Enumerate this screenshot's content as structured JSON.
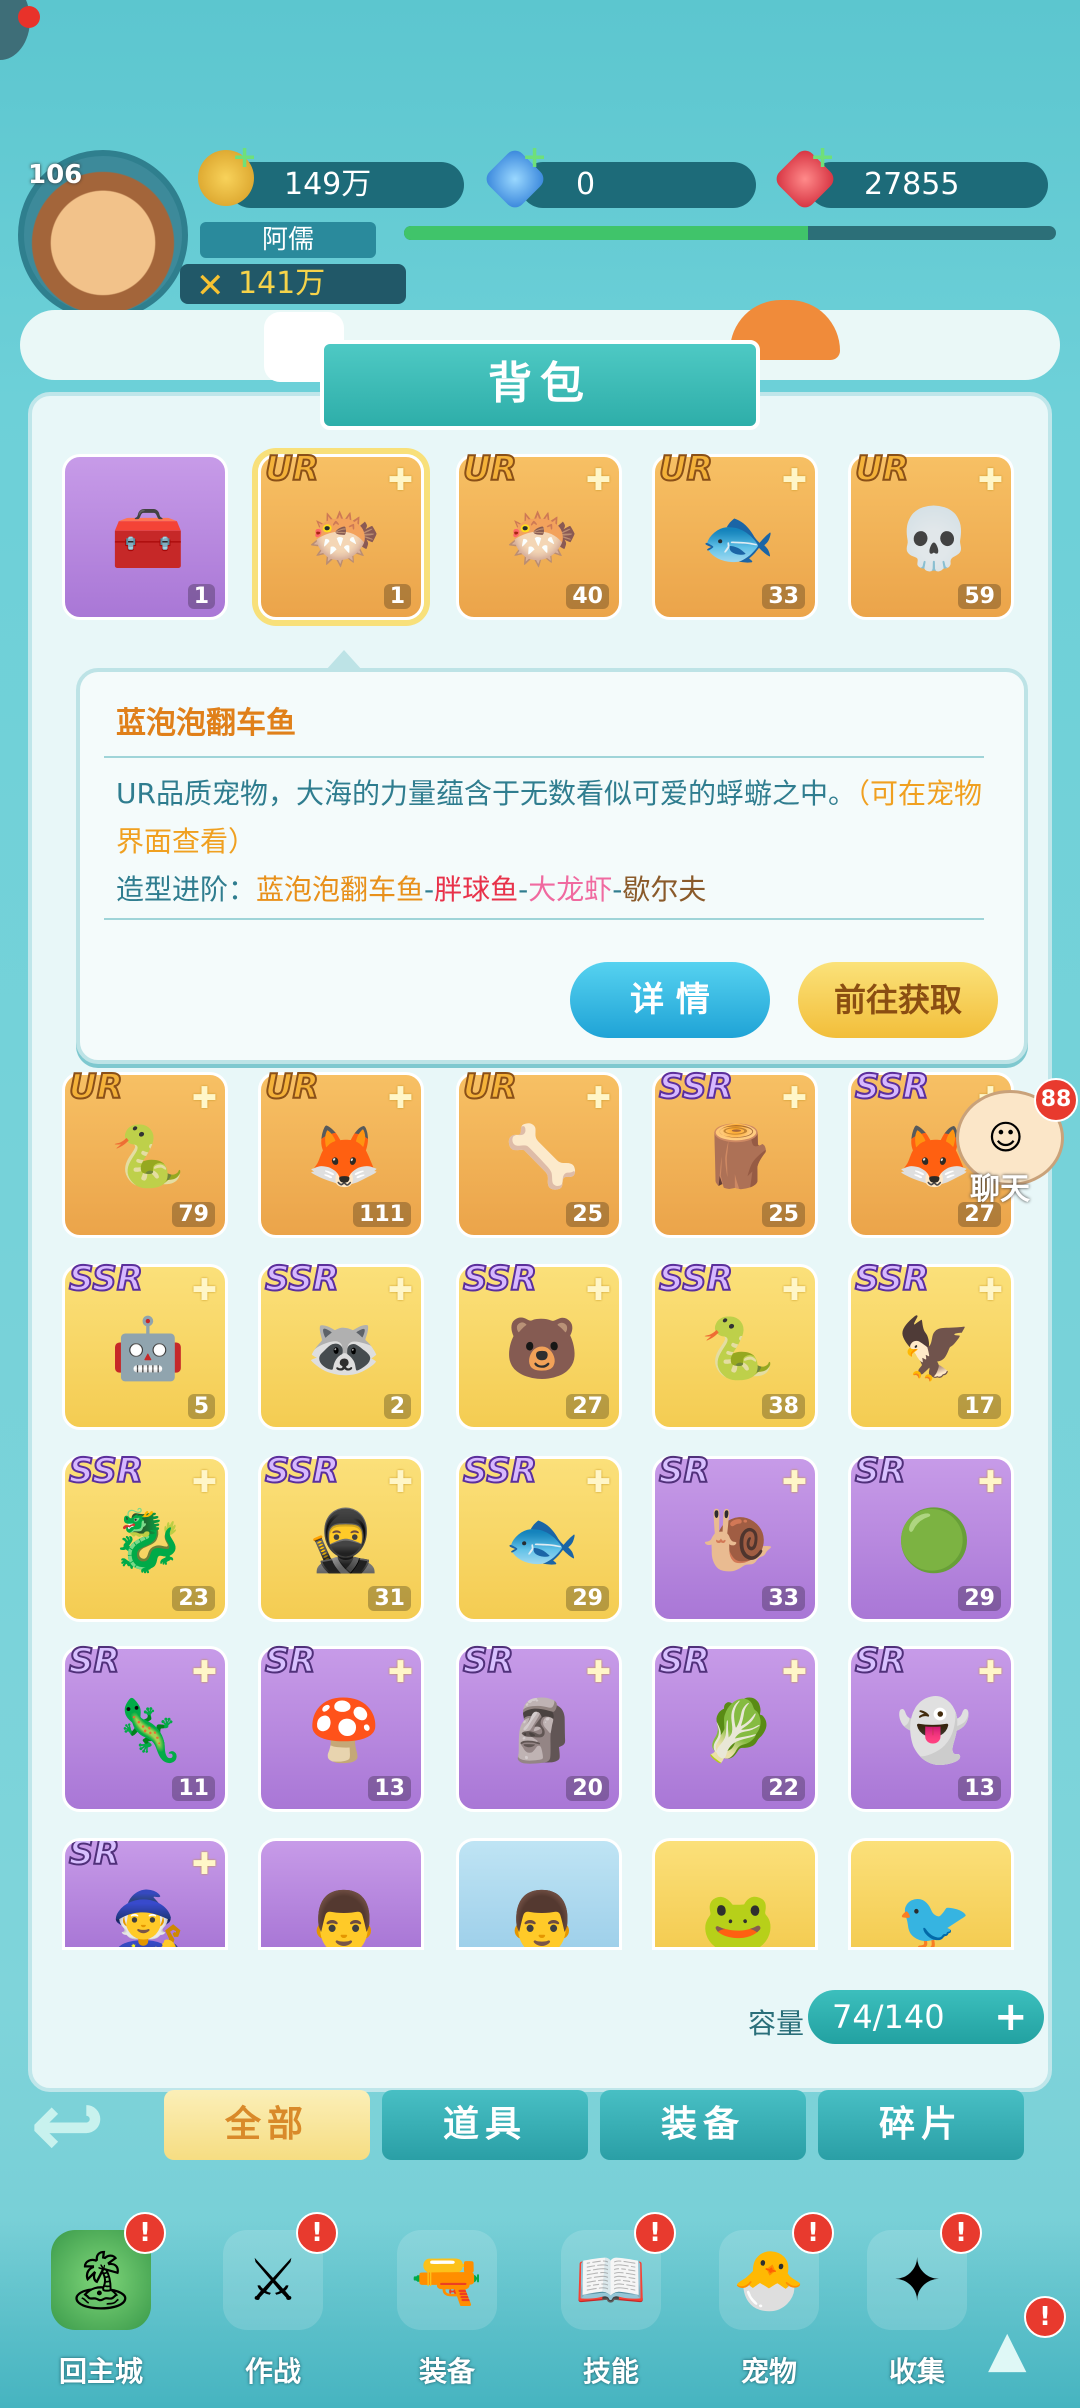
{
  "player": {
    "level": "106",
    "name": "阿儒",
    "power": "141万"
  },
  "resources": {
    "gold": "149万",
    "diamond": "0",
    "ruby": "27855"
  },
  "panel_title": "背包",
  "items_row1": [
    {
      "rarity": "",
      "count": "1",
      "tone": "purple",
      "icon": "chest-icon",
      "glyph": "🧰"
    },
    {
      "rarity": "UR",
      "count": "1",
      "tone": "orange",
      "icon": "puffer-fish-icon",
      "glyph": "🐡"
    },
    {
      "rarity": "UR",
      "count": "40",
      "tone": "orange",
      "icon": "puffer-fish-icon",
      "glyph": "🐡"
    },
    {
      "rarity": "UR",
      "count": "33",
      "tone": "orange",
      "icon": "flying-fish-icon",
      "glyph": "🐟"
    },
    {
      "rarity": "UR",
      "count": "59",
      "tone": "orange",
      "icon": "skeleton-beast-icon",
      "glyph": "💀"
    }
  ],
  "tooltip": {
    "title": "蓝泡泡翻车鱼",
    "desc_main": "UR品质宠物，大海的力量蕴含于无数看似可爱的蜉蝣之中。",
    "desc_note": "（可在宠物界面查看）",
    "evo_label": "造型进阶：",
    "evo_1": "蓝泡泡翻车鱼",
    "evo_2": "胖球鱼",
    "evo_3": "大龙虾",
    "evo_4": "歇尔夫",
    "sep": "-",
    "btn_detail": "详 情",
    "btn_obtain": "前往获取"
  },
  "items_grid": [
    {
      "rarity": "UR",
      "count": "79",
      "tone": "orange",
      "icon": "snake-icon",
      "glyph": "🐍"
    },
    {
      "rarity": "UR",
      "count": "111",
      "tone": "orange",
      "icon": "fox-icon",
      "glyph": "🦊"
    },
    {
      "rarity": "UR",
      "count": "25",
      "tone": "orange",
      "icon": "skeleton-dragon-icon",
      "glyph": "🦴"
    },
    {
      "rarity": "SSR",
      "count": "25",
      "tone": "orange",
      "icon": "tree-stump-icon",
      "glyph": "🪵"
    },
    {
      "rarity": "SSR",
      "count": "27",
      "tone": "orange",
      "icon": "fox-icon",
      "glyph": "🦊"
    },
    {
      "rarity": "SSR",
      "count": "5",
      "tone": "yellow",
      "icon": "robot-icon",
      "glyph": "🤖"
    },
    {
      "rarity": "SSR",
      "count": "2",
      "tone": "yellow",
      "icon": "raccoon-icon",
      "glyph": "🦝"
    },
    {
      "rarity": "SSR",
      "count": "27",
      "tone": "yellow",
      "icon": "bear-icon",
      "glyph": "🐻"
    },
    {
      "rarity": "SSR",
      "count": "38",
      "tone": "yellow",
      "icon": "snake-icon",
      "glyph": "🐍"
    },
    {
      "rarity": "SSR",
      "count": "17",
      "tone": "yellow",
      "icon": "eagle-icon",
      "glyph": "🦅"
    },
    {
      "rarity": "SSR",
      "count": "23",
      "tone": "yellow",
      "icon": "seahorse-icon",
      "glyph": "🐉"
    },
    {
      "rarity": "SSR",
      "count": "31",
      "tone": "yellow",
      "icon": "ninja-icon",
      "glyph": "🥷"
    },
    {
      "rarity": "SSR",
      "count": "29",
      "tone": "yellow",
      "icon": "eel-icon",
      "glyph": "🐟"
    },
    {
      "rarity": "SR",
      "count": "33",
      "tone": "purple",
      "icon": "snail-icon",
      "glyph": "🐌"
    },
    {
      "rarity": "SR",
      "count": "29",
      "tone": "purple",
      "icon": "slime-icon",
      "glyph": "🟢"
    },
    {
      "rarity": "SR",
      "count": "11",
      "tone": "purple",
      "icon": "lizard-icon",
      "glyph": "🦎"
    },
    {
      "rarity": "SR",
      "count": "13",
      "tone": "purple",
      "icon": "mushroom-icon",
      "glyph": "🍄"
    },
    {
      "rarity": "SR",
      "count": "20",
      "tone": "purple",
      "icon": "golem-icon",
      "glyph": "🗿"
    },
    {
      "rarity": "SR",
      "count": "22",
      "tone": "purple",
      "icon": "cabbage-icon",
      "glyph": "🥬"
    },
    {
      "rarity": "SR",
      "count": "13",
      "tone": "purple",
      "icon": "dark-sprite-icon",
      "glyph": "👻"
    },
    {
      "rarity": "SR",
      "count": "",
      "tone": "purple",
      "icon": "wizard-icon",
      "glyph": "🧙"
    },
    {
      "rarity": "",
      "count": "",
      "tone": "purple",
      "icon": "monk-icon",
      "glyph": "👨"
    },
    {
      "rarity": "",
      "count": "",
      "tone": "blue",
      "icon": "monk-icon",
      "glyph": "👨"
    },
    {
      "rarity": "",
      "count": "",
      "tone": "yellow",
      "icon": "frog-icon",
      "glyph": "🐸"
    },
    {
      "rarity": "",
      "count": "",
      "tone": "yellow",
      "icon": "bird-icon",
      "glyph": "🐦"
    }
  ],
  "chat": {
    "badge": "88",
    "label": "聊天"
  },
  "capacity": {
    "label": "容量",
    "value": "74/140",
    "plus": "+"
  },
  "tabs": [
    "全部",
    "道具",
    "装备",
    "碎片"
  ],
  "nav": [
    {
      "label": "回主城",
      "icon": "island-icon",
      "glyph": "🏝"
    },
    {
      "label": "作战",
      "icon": "warrior-icon",
      "glyph": "⚔"
    },
    {
      "label": "装备",
      "icon": "cannon-icon",
      "glyph": "🔫"
    },
    {
      "label": "技能",
      "icon": "skill-book-icon",
      "glyph": "📖"
    },
    {
      "label": "宠物",
      "icon": "pet-icon",
      "glyph": "🐣"
    },
    {
      "label": "收集",
      "icon": "collect-icon",
      "glyph": "✦"
    }
  ],
  "nav_badge": "!"
}
